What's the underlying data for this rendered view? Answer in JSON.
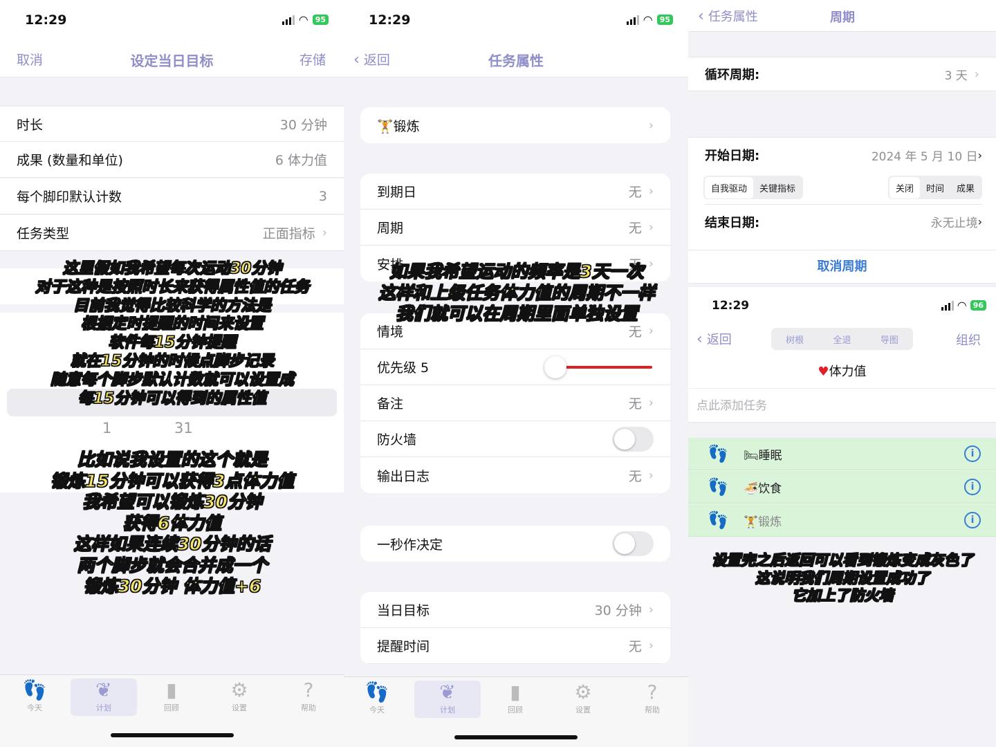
{
  "status": {
    "p1_time": "12:29",
    "p1_batt": "95",
    "p2_time": "12:29",
    "p2_batt": "95",
    "p3_time": "12:29",
    "p3_batt": "96"
  },
  "panel1": {
    "nav": {
      "cancel": "取消",
      "title": "设定当日目标",
      "save": "存储"
    },
    "rows": [
      {
        "label": "时长",
        "value": "30 分钟"
      },
      {
        "label": "成果 (数量和单位)",
        "value": "6 体力值"
      },
      {
        "label": "每个脚印默认计数",
        "value": "3"
      },
      {
        "label": "任务类型",
        "value": "正面指标"
      }
    ],
    "picker": {
      "a": "1",
      "b": "31"
    },
    "overlay1": [
      "这里假如我希望每次运动30分钟",
      "对于这种是按照时长来获得属性值的任务",
      "目前我觉得比较科学的方法是",
      "根据定时提醒的时间来设置",
      "软件每15分钟提醒",
      "就在15分钟的时候点脚步记录",
      "随意每个脚步默认计数就可以设置成",
      "每15分钟可以得到的属性值"
    ],
    "overlay2": [
      "比如说我设置的这个就是",
      "锻炼15分钟可以获得3点体力值",
      "我希望可以锻炼30分钟",
      "获得6体力值",
      "这样如果连续30分钟的话",
      "两个脚步就会合并成一个",
      "锻炼30分钟 体力值+6"
    ]
  },
  "panel2": {
    "nav": {
      "back": "返回",
      "title": "任务属性"
    },
    "task": "锻炼",
    "group1": [
      {
        "label": "到期日",
        "value": "无"
      },
      {
        "label": "周期",
        "value": "无"
      },
      {
        "label": "安排",
        "value": "无"
      }
    ],
    "group2": [
      {
        "label": "情境",
        "value": "无"
      },
      {
        "label": "优先级 5",
        "value": ""
      },
      {
        "label": "备注",
        "value": "无"
      },
      {
        "label": "防火墙",
        "value": ""
      },
      {
        "label": "输出日志",
        "value": "无"
      }
    ],
    "quick": "一秒作决定",
    "group3": [
      {
        "label": "当日目标",
        "value": "30 分钟"
      },
      {
        "label": "提醒时间",
        "value": "无"
      }
    ],
    "overlay": [
      "如果我希望运动的频率是3天一次",
      "这样和上级任务体力值的周期不一样",
      "我们就可以在周期里面单独设置"
    ]
  },
  "panel3": {
    "nav": {
      "back": "任务属性",
      "title": "周期"
    },
    "cycle": {
      "label": "循环周期:",
      "value": "3 天"
    },
    "start": {
      "label": "开始日期:",
      "value": "2024 年 5 月 10 日"
    },
    "seg_left": [
      "自我驱动",
      "关键指标"
    ],
    "seg_right": [
      "关闭",
      "时间",
      "成果"
    ],
    "end": {
      "label": "结束日期:",
      "value": "永无止境"
    },
    "cancel_cycle": "取消周期",
    "nav2": {
      "back": "返回",
      "seg": [
        "树根",
        "全退",
        "导图"
      ],
      "right": "组织"
    },
    "group_title": "体力值",
    "add_placeholder": "点此添加任务",
    "tasks": [
      "睡眠",
      "饮食",
      "锻炼"
    ],
    "overlay": [
      "设置完之后返回可以看到锻炼变成灰色了",
      "这说明我们周期设置成功了",
      "它加上了防火墙"
    ]
  },
  "tabbar": [
    "今天",
    "计划",
    "回顾",
    "设置",
    "帮助"
  ],
  "colors": {
    "accent": "#8e8ec8",
    "blue": "#3a7bd5",
    "green_row": "#d9f4d9",
    "slider": "#e02020",
    "overlay_text": "#f5e66a"
  }
}
